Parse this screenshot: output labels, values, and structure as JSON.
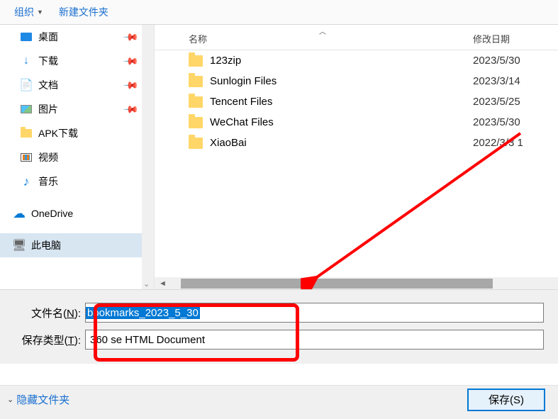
{
  "toolbar": {
    "organize": "组织",
    "new_folder": "新建文件夹"
  },
  "sidebar": {
    "items": [
      {
        "label": "桌面",
        "icon": "desktop",
        "pinned": true
      },
      {
        "label": "下载",
        "icon": "download",
        "pinned": true
      },
      {
        "label": "文档",
        "icon": "docs",
        "pinned": true
      },
      {
        "label": "图片",
        "icon": "pics",
        "pinned": true
      },
      {
        "label": "APK下载",
        "icon": "folder",
        "pinned": false
      },
      {
        "label": "视频",
        "icon": "video",
        "pinned": false
      },
      {
        "label": "音乐",
        "icon": "music",
        "pinned": false
      }
    ],
    "onedrive": "OneDrive",
    "this_pc": "此电脑"
  },
  "columns": {
    "name": "名称",
    "modified": "修改日期"
  },
  "files": [
    {
      "name": "123zip",
      "date": "2023/5/30"
    },
    {
      "name": "Sunlogin Files",
      "date": "2023/3/14"
    },
    {
      "name": "Tencent Files",
      "date": "2023/5/25"
    },
    {
      "name": "WeChat Files",
      "date": "2023/5/30"
    },
    {
      "name": "XiaoBai",
      "date": "2022/3/3 1"
    }
  ],
  "form": {
    "filename_label_pre": "文件名(",
    "filename_label_key": "N",
    "filename_label_post": "):",
    "filename_value": "bookmarks_2023_5_30",
    "filetype_label_pre": "保存类型(",
    "filetype_label_key": "T",
    "filetype_label_post": "):",
    "filetype_value": "360 se HTML Document"
  },
  "footer": {
    "hide_folders": "隐藏文件夹",
    "save": "保存(S)"
  }
}
